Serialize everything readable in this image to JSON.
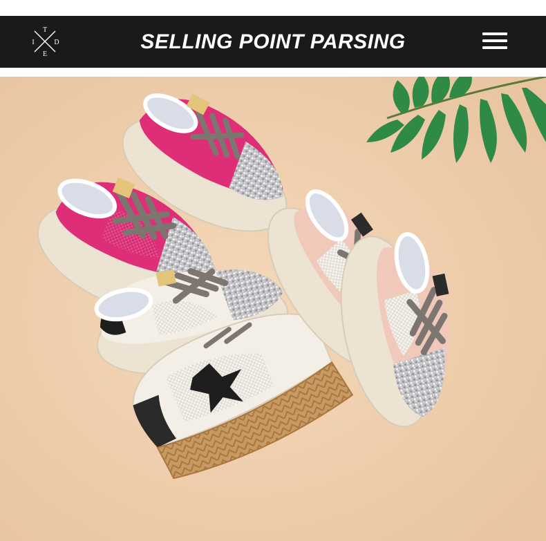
{
  "header": {
    "title": "SELLING POINT PARSING",
    "logo_letters": {
      "top": "T",
      "left": "I",
      "right": "D",
      "bottom": "E"
    },
    "menu_icon": "hamburger-menu-icon"
  },
  "colors": {
    "banner": "#1a1a1a",
    "backdrop": "#efcfae",
    "pink_shoe": "#dd2e77",
    "blush_shoe": "#f1c9bb",
    "white_shoe": "#f4efe6",
    "sole": "#ece3d3",
    "laces": "#7d7670",
    "leaf": "#2f8a45"
  },
  "photo": {
    "subject": "Five children's sneakers with sequin toe caps, grey laces and mesh panels"
  }
}
